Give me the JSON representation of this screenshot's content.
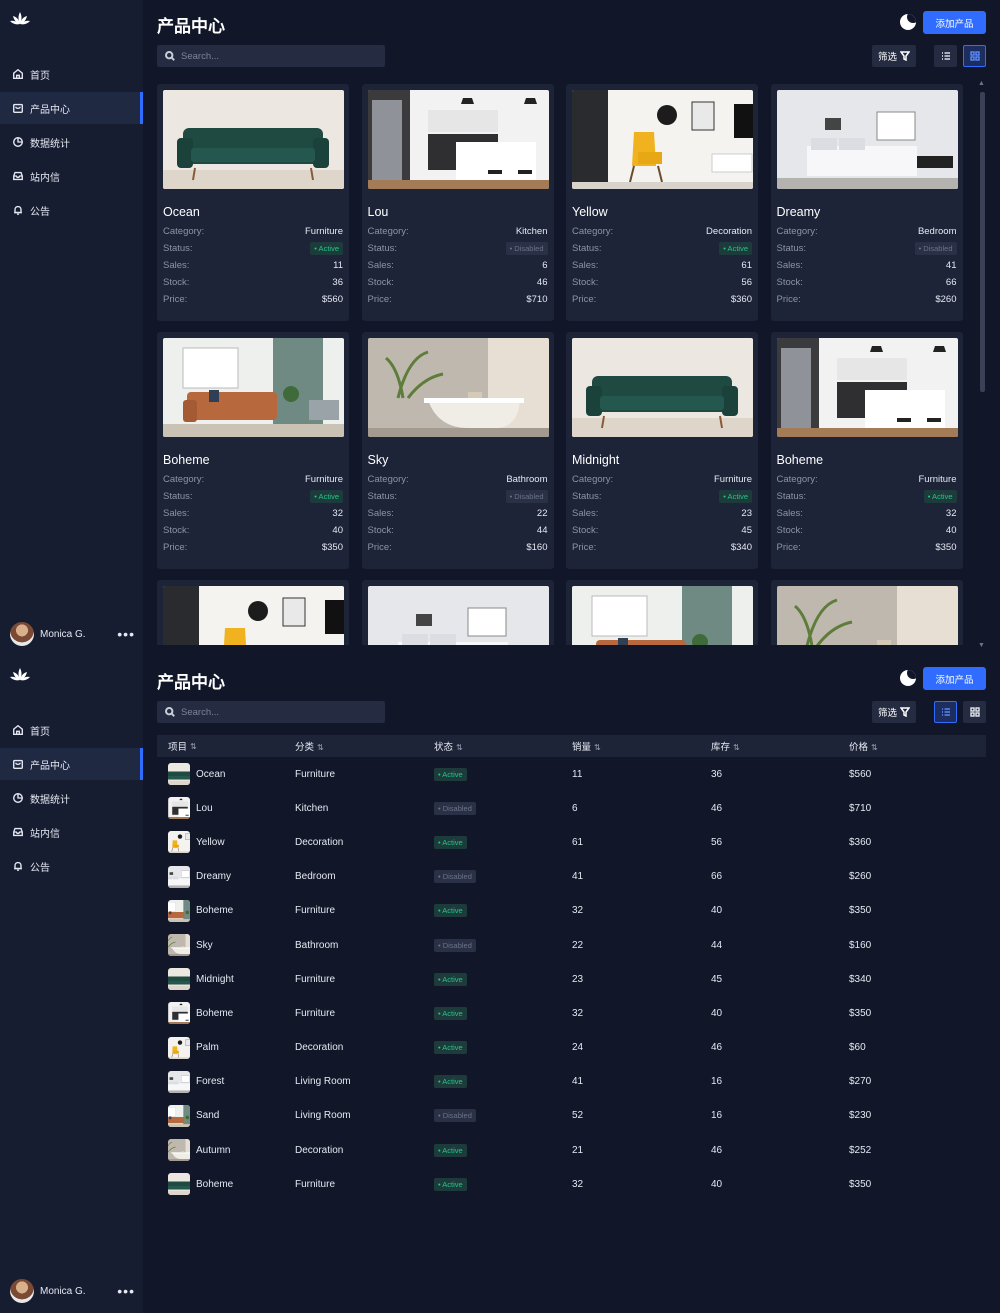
{
  "app": {
    "logo_icon": "lotus-icon",
    "nav": [
      {
        "label": "首页",
        "icon": "home-icon"
      },
      {
        "label": "产品中心",
        "icon": "bag-icon"
      },
      {
        "label": "数据统计",
        "icon": "pie-chart-icon"
      },
      {
        "label": "站内信",
        "icon": "inbox-icon"
      },
      {
        "label": "公告",
        "icon": "bell-icon"
      }
    ],
    "active_nav_index": 1,
    "user": {
      "name": "Monica G.",
      "more_label": "•••"
    },
    "accent": "#2f6cff"
  },
  "header": {
    "title": "产品中心",
    "add_label": "添加产品",
    "filter_label": "筛选",
    "search_placeholder": "Search..."
  },
  "labels": {
    "category": "Category:",
    "status": "Status:",
    "sales": "Sales:",
    "stock": "Stock:",
    "price": "Price:"
  },
  "table_headers": [
    "项目",
    "分类",
    "状态",
    "销量",
    "库存",
    "价格"
  ],
  "status_text": {
    "active": "• Active",
    "disabled": "• Disabled"
  },
  "status_colors": {
    "active": "#25c48a",
    "disabled": "#6b7389"
  },
  "products": [
    {
      "name": "Ocean",
      "category": "Furniture",
      "status": "active",
      "sales": "11",
      "stock": "36",
      "price": "$560",
      "scene": "sofa"
    },
    {
      "name": "Lou",
      "category": "Kitchen",
      "status": "disabled",
      "sales": "6",
      "stock": "46",
      "price": "$710",
      "scene": "kitchen"
    },
    {
      "name": "Yellow",
      "category": "Decoration",
      "status": "active",
      "sales": "61",
      "stock": "56",
      "price": "$360",
      "scene": "chair"
    },
    {
      "name": "Dreamy",
      "category": "Bedroom",
      "status": "disabled",
      "sales": "41",
      "stock": "66",
      "price": "$260",
      "scene": "bedroom"
    },
    {
      "name": "Boheme",
      "category": "Furniture",
      "status": "active",
      "sales": "32",
      "stock": "40",
      "price": "$350",
      "scene": "living"
    },
    {
      "name": "Sky",
      "category": "Bathroom",
      "status": "disabled",
      "sales": "22",
      "stock": "44",
      "price": "$160",
      "scene": "bath"
    },
    {
      "name": "Midnight",
      "category": "Furniture",
      "status": "active",
      "sales": "23",
      "stock": "45",
      "price": "$340",
      "scene": "sofa"
    },
    {
      "name": "Boheme",
      "category": "Furniture",
      "status": "active",
      "sales": "32",
      "stock": "40",
      "price": "$350",
      "scene": "kitchen"
    },
    {
      "name": "Palm",
      "category": "Decoration",
      "status": "active",
      "sales": "24",
      "stock": "46",
      "price": "$60",
      "scene": "chair"
    },
    {
      "name": "Forest",
      "category": "Living Room",
      "status": "active",
      "sales": "41",
      "stock": "16",
      "price": "$270",
      "scene": "bedroom"
    },
    {
      "name": "Sand",
      "category": "Living Room",
      "status": "disabled",
      "sales": "52",
      "stock": "16",
      "price": "$230",
      "scene": "living"
    },
    {
      "name": "Autumn",
      "category": "Decoration",
      "status": "active",
      "sales": "21",
      "stock": "46",
      "price": "$252",
      "scene": "bath"
    },
    {
      "name": "Boheme",
      "category": "Furniture",
      "status": "active",
      "sales": "32",
      "stock": "40",
      "price": "$350",
      "scene": "sofa"
    }
  ]
}
